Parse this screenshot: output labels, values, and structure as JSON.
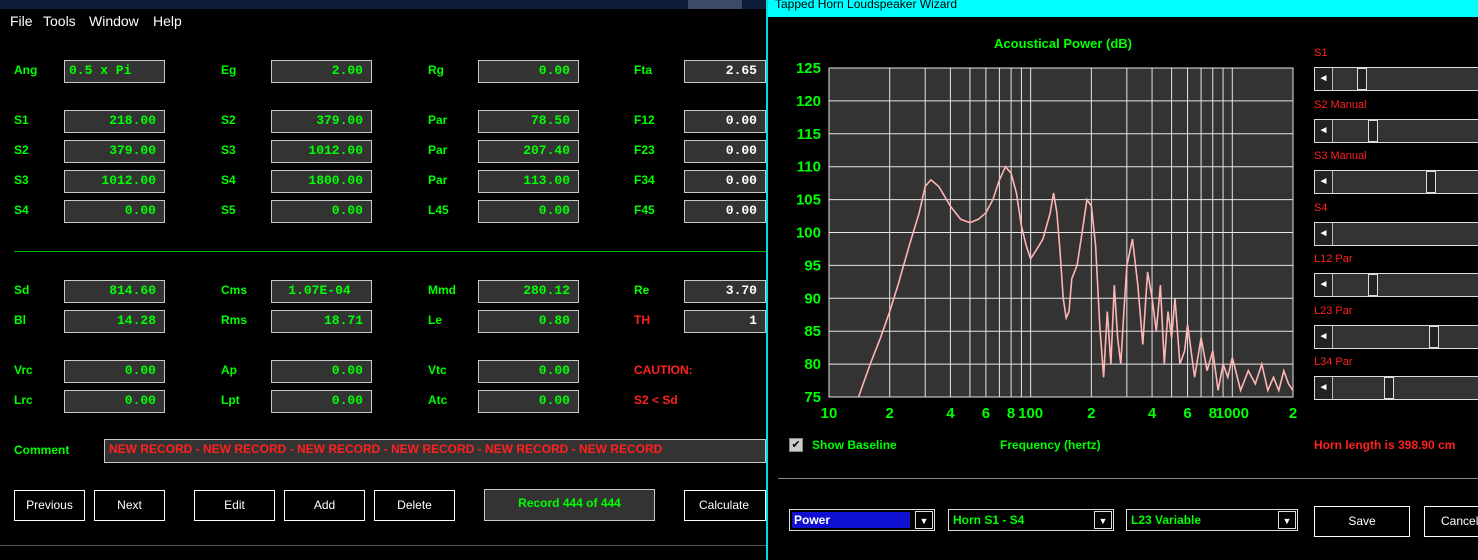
{
  "menu": [
    "File",
    "Tools",
    "Window",
    "Help"
  ],
  "fields": [
    {
      "label": "Ang",
      "value": "0.5 x Pi"
    },
    {
      "label": "Eg",
      "value": "2.00"
    },
    {
      "label": "Rg",
      "value": "0.00"
    },
    {
      "label": "Fta",
      "value": "2.65"
    },
    {
      "label": "S1",
      "value": "218.00"
    },
    {
      "label": "S2",
      "value": "379.00"
    },
    {
      "label": "Par",
      "value": "78.50"
    },
    {
      "label": "F12",
      "value": "0.00"
    },
    {
      "label": "S2",
      "value": "379.00"
    },
    {
      "label": "S3",
      "value": "1012.00"
    },
    {
      "label": "Par",
      "value": "207.40"
    },
    {
      "label": "F23",
      "value": "0.00"
    },
    {
      "label": "S3",
      "value": "1012.00"
    },
    {
      "label": "S4",
      "value": "1800.00"
    },
    {
      "label": "Par",
      "value": "113.00"
    },
    {
      "label": "F34",
      "value": "0.00"
    },
    {
      "label": "S4",
      "value": "0.00"
    },
    {
      "label": "S5",
      "value": "0.00"
    },
    {
      "label": "L45",
      "value": "0.00"
    },
    {
      "label": "F45",
      "value": "0.00"
    },
    {
      "label": "Sd",
      "value": "814.60"
    },
    {
      "label": "Cms",
      "value": "1.07E-04"
    },
    {
      "label": "Mmd",
      "value": "280.12"
    },
    {
      "label": "Re",
      "value": "3.70"
    },
    {
      "label": "Bl",
      "value": "14.28"
    },
    {
      "label": "Rms",
      "value": "18.71"
    },
    {
      "label": "Le",
      "value": "0.80"
    },
    {
      "label": "TH",
      "value": "1"
    },
    {
      "label": "Vrc",
      "value": "0.00"
    },
    {
      "label": "Ap",
      "value": "0.00"
    },
    {
      "label": "Vtc",
      "value": "0.00"
    },
    {
      "label": "Lrc",
      "value": "0.00"
    },
    {
      "label": "Lpt",
      "value": "0.00"
    },
    {
      "label": "Atc",
      "value": "0.00"
    }
  ],
  "caution": "CAUTION:",
  "caution_msg": "S2 < Sd",
  "comment_label": "Comment",
  "comment_value": "NEW RECORD - NEW RECORD - NEW RECORD - NEW RECORD - NEW RECORD - NEW RECORD",
  "buttons": {
    "previous": "Previous",
    "next": "Next",
    "edit": "Edit",
    "add": "Add",
    "delete": "Delete",
    "record": "Record 444 of 444",
    "calculate": "Calculate"
  },
  "wizard": {
    "title": "Tapped Horn Loudspeaker Wizard",
    "show_baseline": "Show Baseline",
    "show_baseline_checked": true,
    "frequency_label": "Frequency (hertz)",
    "horn_length": "Horn length is 398.90 cm",
    "sliders": [
      {
        "label": "S1",
        "value": 0.14
      },
      {
        "label": "S2 Manual",
        "value": 0.21
      },
      {
        "label": "S3 Manual",
        "value": 0.55
      },
      {
        "label": "S4",
        "value": 1.0
      },
      {
        "label": "L12 Par",
        "value": 0.21
      },
      {
        "label": "L23 Par",
        "value": 0.57
      },
      {
        "label": "L34 Par",
        "value": 0.3
      }
    ],
    "combos": {
      "power": "Power",
      "horn": "Horn S1 - S4",
      "l23": "L23 Variable"
    },
    "save": "Save",
    "cancel": "Cancel"
  },
  "chart_data": {
    "type": "line",
    "title": "Acoustical Power (dB)",
    "xlabel": "Frequency (hertz)",
    "ylabel": "",
    "xscale": "log",
    "xlim": [
      10,
      2000
    ],
    "ylim": [
      75,
      125
    ],
    "yticks": [
      75,
      80,
      85,
      90,
      95,
      100,
      105,
      110,
      115,
      120,
      125
    ],
    "xtick_labels": [
      "10",
      "2",
      "4",
      "6",
      "8",
      "100",
      "2",
      "4",
      "6",
      "8",
      "1000",
      "2"
    ],
    "grid": true,
    "colors": {
      "line": "#ffb4b4",
      "grid": "#e6e6e6",
      "bg": "#333333"
    },
    "series": [
      {
        "x": [
          14,
          16,
          18,
          20,
          22,
          25,
          28,
          30,
          32,
          35,
          40,
          45,
          50,
          55,
          60,
          65,
          70,
          75,
          80,
          85,
          90,
          95,
          100,
          105,
          110,
          115,
          120,
          125,
          130,
          135,
          140,
          145,
          150,
          155,
          160,
          170,
          180,
          190,
          200,
          210,
          220,
          230,
          240,
          250,
          260,
          270,
          280,
          290,
          300,
          320,
          340,
          360,
          380,
          400,
          420,
          440,
          460,
          480,
          500,
          520,
          550,
          580,
          600,
          650,
          700,
          750,
          800,
          850,
          900,
          950,
          1000,
          1100,
          1200,
          1300,
          1400,
          1500,
          1600,
          1700,
          1800,
          1900,
          2000
        ],
        "y": [
          75,
          80,
          84,
          88,
          92,
          98,
          103,
          107,
          108,
          107,
          104,
          102,
          101.5,
          102,
          103,
          105,
          108,
          110,
          109,
          106,
          101,
          98,
          96,
          97,
          98,
          99,
          101,
          103,
          106,
          103,
          97,
          90,
          87,
          88,
          93,
          95,
          100,
          105,
          104,
          98,
          86,
          78,
          88,
          80,
          92,
          84,
          80,
          88,
          95,
          99,
          92,
          83,
          94,
          90,
          85,
          92,
          80,
          88,
          84,
          90,
          80,
          82,
          86,
          78,
          84,
          79,
          82,
          76,
          80,
          78,
          81,
          76,
          79,
          77,
          80,
          76,
          78,
          76,
          79,
          77,
          76
        ]
      }
    ]
  }
}
